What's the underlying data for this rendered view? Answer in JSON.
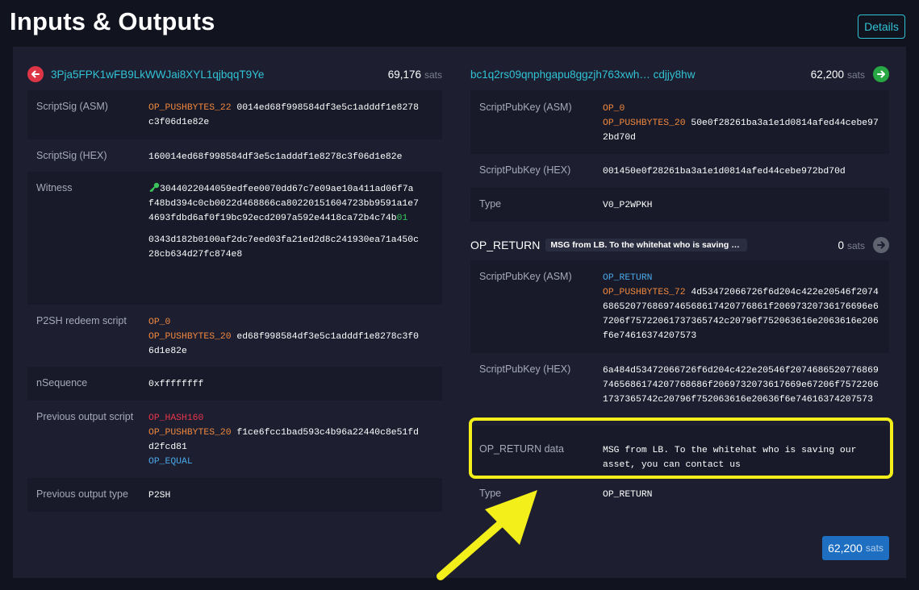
{
  "page_title": "Inputs & Outputs",
  "details_button": "Details",
  "colors": {
    "accent": "#31c3d4",
    "opcode_orange": "#f0883e",
    "opcode_red": "#e8344a",
    "opcode_blue": "#4ba8e8",
    "highlight": "#f3ef1a"
  },
  "input": {
    "address": "3Pja5FPK1wFB9LkWWJai8XYL1qjbqqT9Ye",
    "amount": "69,176",
    "unit": "sats",
    "scriptsig_asm_label": "ScriptSig (ASM)",
    "scriptsig_asm_op": "OP_PUSHBYTES_22",
    "scriptsig_asm_data": "0014ed68f998584df3e5c1adddf1e8278c3f06d1e82e",
    "scriptsig_hex_label": "ScriptSig (HEX)",
    "scriptsig_hex": "160014ed68f998584df3e5c1adddf1e8278c3f06d1e82e",
    "witness_label": "Witness",
    "witness_1_main": "3044022044059edfee0070dd67c7e09ae10a411ad06f7af48bd394c0cb0022d468866ca80220151604723bb9591a1e74693fdbd6af0f19bc92ecd2097a592e4418ca72b4c74b",
    "witness_1_sighash": "01",
    "witness_2": "0343d182b0100af2dc7eed03fa21ed2d8c241930ea71a450c28cb634d27fc874e8",
    "p2sh_label": "P2SH redeem script",
    "p2sh_op1": "OP_0",
    "p2sh_op2": "OP_PUSHBYTES_20",
    "p2sh_data": "ed68f998584df3e5c1adddf1e8278c3f06d1e82e",
    "nsequence_label": "nSequence",
    "nsequence": "0xffffffff",
    "prev_script_label": "Previous output script",
    "prev_op1": "OP_HASH160",
    "prev_op2": "OP_PUSHBYTES_20",
    "prev_data": "f1ce6fcc1bad593c4b96a22440c8e51fdd2fcd81",
    "prev_op3": "OP_EQUAL",
    "prev_type_label": "Previous output type",
    "prev_type": "P2SH"
  },
  "output1": {
    "address": "bc1q2rs09qnphgapu8ggzjh763xwh… cdjjy8hw",
    "amount": "62,200",
    "unit": "sats",
    "asm_label": "ScriptPubKey (ASM)",
    "asm_op1": "OP_0",
    "asm_op2": "OP_PUSHBYTES_20",
    "asm_data": "50e0f28261ba3a1e1d0814afed44cebe972bd70d",
    "hex_label": "ScriptPubKey (HEX)",
    "hex": "001450e0f28261ba3a1e1d0814afed44cebe972bd70d",
    "type_label": "Type",
    "type": "V0_P2WPKH"
  },
  "output2": {
    "label": "OP_RETURN",
    "badge": "MSG from LB. To the whitehat who is saving o...",
    "amount": "0",
    "unit": "sats",
    "asm_label": "ScriptPubKey (ASM)",
    "asm_op1": "OP_RETURN",
    "asm_op2": "OP_PUSHBYTES_72",
    "asm_data": "4d53472066726f6d204c422e20546f2074686520776869746568617420776861f20697320736176696e67206f75722061737365742c20796f752063616e2063616e206f6e74616374207573",
    "hex_label": "ScriptPubKey (HEX)",
    "hex": "6a484d53472066726f6d204c422e20546f20746865207768697465686174207768686f2069732073617669e67206f75722061737365742c20796f752063616e20636f6e74616374207573",
    "data_label": "OP_RETURN data",
    "data": "MSG from LB. To the whitehat who is saving our asset, you can contact us",
    "type_label": "Type",
    "type": "OP_RETURN"
  },
  "total": {
    "amount": "62,200",
    "unit": "sats"
  }
}
